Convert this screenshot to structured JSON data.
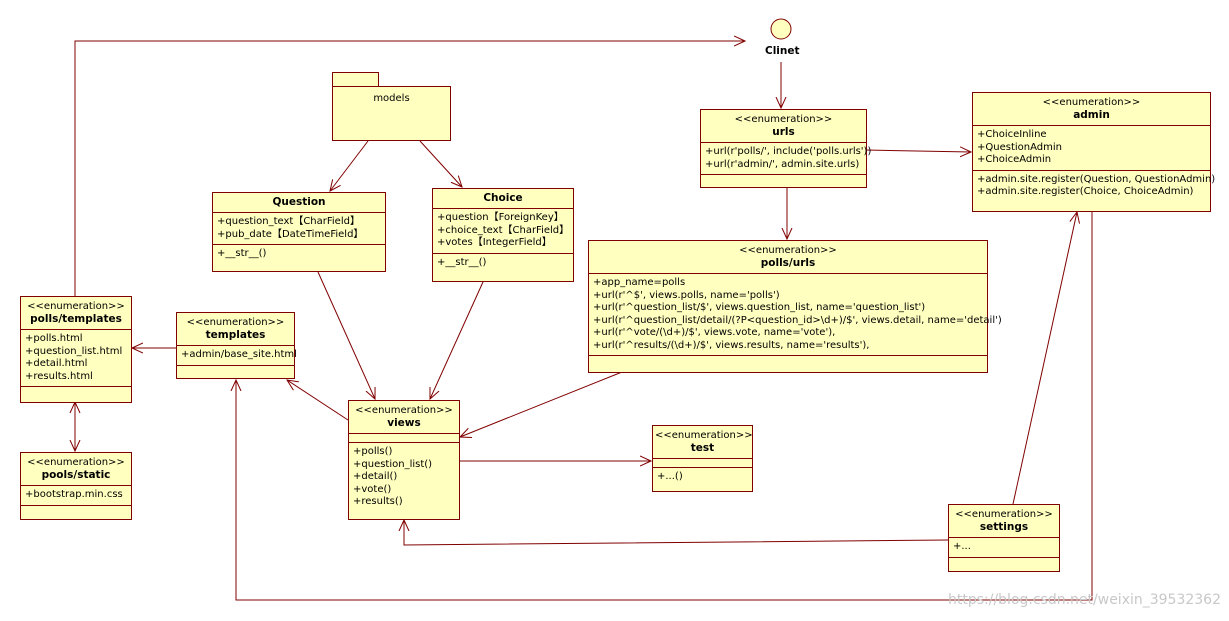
{
  "client": {
    "label": "Clinet"
  },
  "models": {
    "label": "models"
  },
  "question": {
    "name": "Question",
    "attrs": [
      "+question_text【CharField】",
      "+pub_date【DateTimeField】"
    ],
    "methods": [
      "+__str__()"
    ]
  },
  "choice": {
    "name": "Choice",
    "attrs": [
      "+question【ForeignKey】",
      "+choice_text【CharField】",
      "+votes【IntegerField】"
    ],
    "methods": [
      "+__str__()"
    ]
  },
  "urls": {
    "stereotype": "<<enumeration>>",
    "name": "urls",
    "attrs": [
      "+url(r'polls/', include('polls.urls'))",
      "+url(r'admin/', admin.site.urls)"
    ]
  },
  "admin": {
    "stereotype": "<<enumeration>>",
    "name": "admin",
    "attrs": [
      "+ChoiceInline",
      "+QuestionAdmin",
      "+ChoiceAdmin"
    ],
    "methods": [
      "+admin.site.register(Question, QuestionAdmin)",
      "+admin.site.register(Choice, ChoiceAdmin)"
    ]
  },
  "polls_urls": {
    "stereotype": "<<enumeration>>",
    "name": "polls/urls",
    "attrs": [
      "+app_name=polls",
      "+url(r'^$', views.polls, name='polls')",
      "+url(r'^question_list/$', views.question_list, name='question_list')",
      "+url(r'^question_list/detail/(?P<question_id>\\d+)/$', views.detail, name='detail')",
      "+url(r'^vote/(\\d+)/$', views.vote, name='vote'),",
      "+url(r'^results/(\\d+)/$', views.results, name='results'),"
    ]
  },
  "polls_templates": {
    "stereotype": "<<enumeration>>",
    "name": "polls/templates",
    "attrs": [
      "+polls.html",
      "+question_list.html",
      "+detail.html",
      "+results.html"
    ]
  },
  "templates": {
    "stereotype": "<<enumeration>>",
    "name": "templates",
    "attrs": [
      "+admin/base_site.html"
    ]
  },
  "pools_static": {
    "stereotype": "<<enumeration>>",
    "name": "pools/static",
    "attrs": [
      "+bootstrap.min.css"
    ]
  },
  "views": {
    "stereotype": "<<enumeration>>",
    "name": "views",
    "methods": [
      "+polls()",
      "+question_list()",
      "+detail()",
      "+vote()",
      "+results()"
    ]
  },
  "test": {
    "stereotype": "<<enumeration>>",
    "name": "test",
    "methods": [
      "+...()"
    ]
  },
  "settings": {
    "stereotype": "<<enumeration>>",
    "name": "settings",
    "attrs": [
      "+..."
    ]
  },
  "watermark": "https://blog.csdn.net/weixin_39532362",
  "colors": {
    "box_fill": "#ffffc0",
    "line": "#800000"
  }
}
